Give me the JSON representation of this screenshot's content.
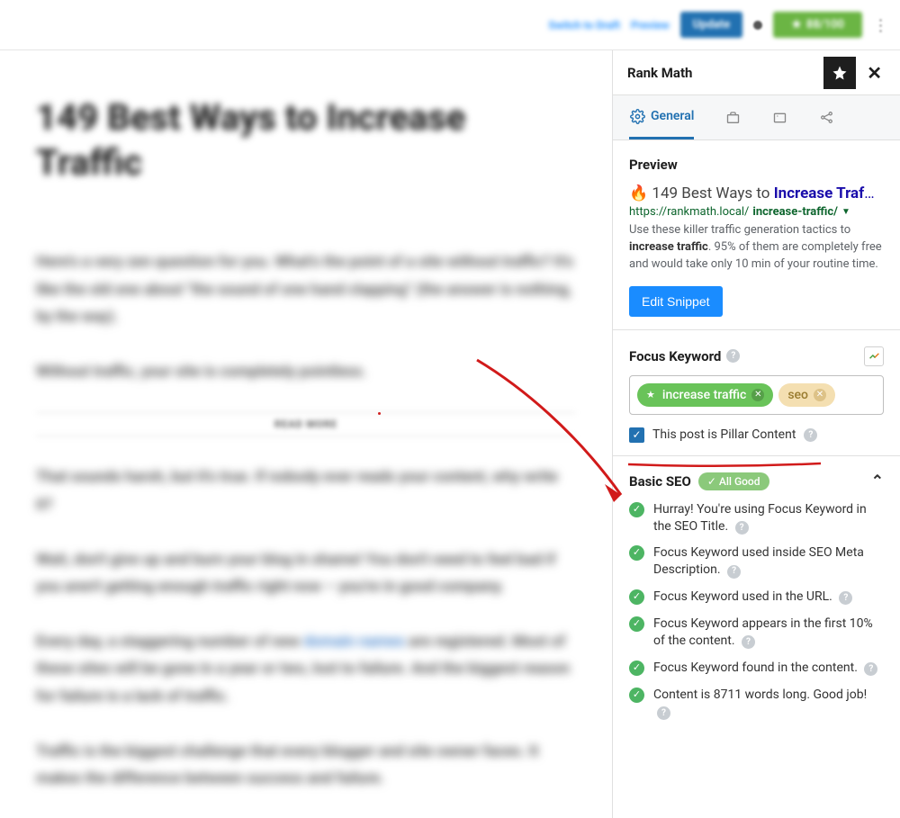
{
  "topbar": {
    "switch_to_draft": "Switch to Draft",
    "preview": "Preview",
    "update": "Update",
    "score_badge": "88/100"
  },
  "editor": {
    "title": "149 Best Ways to Increase Traffic",
    "p1": "Here's a very zen question for you. What's the point of a site without traffic? It's like the old one about \"the sound of one hand clapping\" (the answer is nothing, by the way).",
    "p2": "Without traffic, your site is completely pointless.",
    "readmore": "READ MORE",
    "p3": "That sounds harsh, but it's true. If nobody ever reads your content, why write it?",
    "p4": "Wait, don't give up and burn your blog in shame! You don't need to feel bad if you aren't getting enough traffic right now – you're in good company.",
    "p5_a": "Every day, a staggering number of new ",
    "p5_link": "domain names",
    "p5_b": " are registered. Most of these sites will be gone in a year or two, lost to failure. And the biggest reason for failure is a lack of traffic.",
    "p6": "Traffic is the biggest challenge that every blogger and site owner faces. It makes the difference between success and failure."
  },
  "panel": {
    "title": "Rank Math",
    "tabs": {
      "general": "General"
    },
    "preview": {
      "section_label": "Preview",
      "emoji": "🔥",
      "title_left": " 149 Best Ways to ",
      "title_bold": "Increase Traf",
      "title_ellipsis": "…",
      "url_left": "https://rankmath.local/",
      "url_bold": "increase-traffic/",
      "desc_before": "Use these killer traffic generation tactics to ",
      "desc_bold": "increase traffic",
      "desc_after": ". 95% of them are completely free and would take only 10 min of your routine time.",
      "edit_label": "Edit Snippet"
    },
    "focus": {
      "section_label": "Focus Keyword",
      "keywords": [
        {
          "text": "increase traffic",
          "style": "green",
          "primary": true
        },
        {
          "text": "seo",
          "style": "yellow",
          "primary": false
        }
      ],
      "pillar_label": "This post is Pillar Content",
      "pillar_checked": true
    },
    "basic": {
      "section_label": "Basic SEO",
      "pill_label": "✓ All Good",
      "items": [
        "Hurray! You're using Focus Keyword in the SEO Title.",
        "Focus Keyword used inside SEO Meta Description.",
        "Focus Keyword used in the URL.",
        "Focus Keyword appears in the first 10% of the content.",
        "Focus Keyword found in the content.",
        "Content is 8711 words long. Good job!"
      ]
    }
  }
}
